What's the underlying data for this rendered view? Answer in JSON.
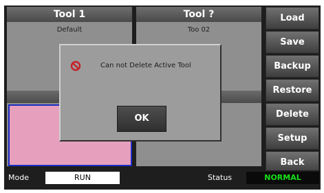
{
  "tool_panels": [
    {
      "title": "Tool 1",
      "subtitle": "Default"
    },
    {
      "title": "Tool ?",
      "subtitle": "Too 02"
    }
  ],
  "side_menu": [
    "Load",
    "Save",
    "Backup",
    "Restore",
    "Delete",
    "Setup",
    "Back"
  ],
  "status_bar": {
    "mode_label": "Mode",
    "mode_value": "RUN",
    "status_label": "Status",
    "status_value": "NORMAL"
  },
  "dialog": {
    "icon": "prohibited-icon",
    "message": "Can not Delete Active Tool",
    "ok_label": "OK"
  },
  "colors": {
    "panel": "#8f8f8f",
    "highlight_fill": "#e69fbd",
    "highlight_border": "#1a2cc4",
    "status_ok": "#18e018",
    "prohibit_red": "#c8202a"
  }
}
